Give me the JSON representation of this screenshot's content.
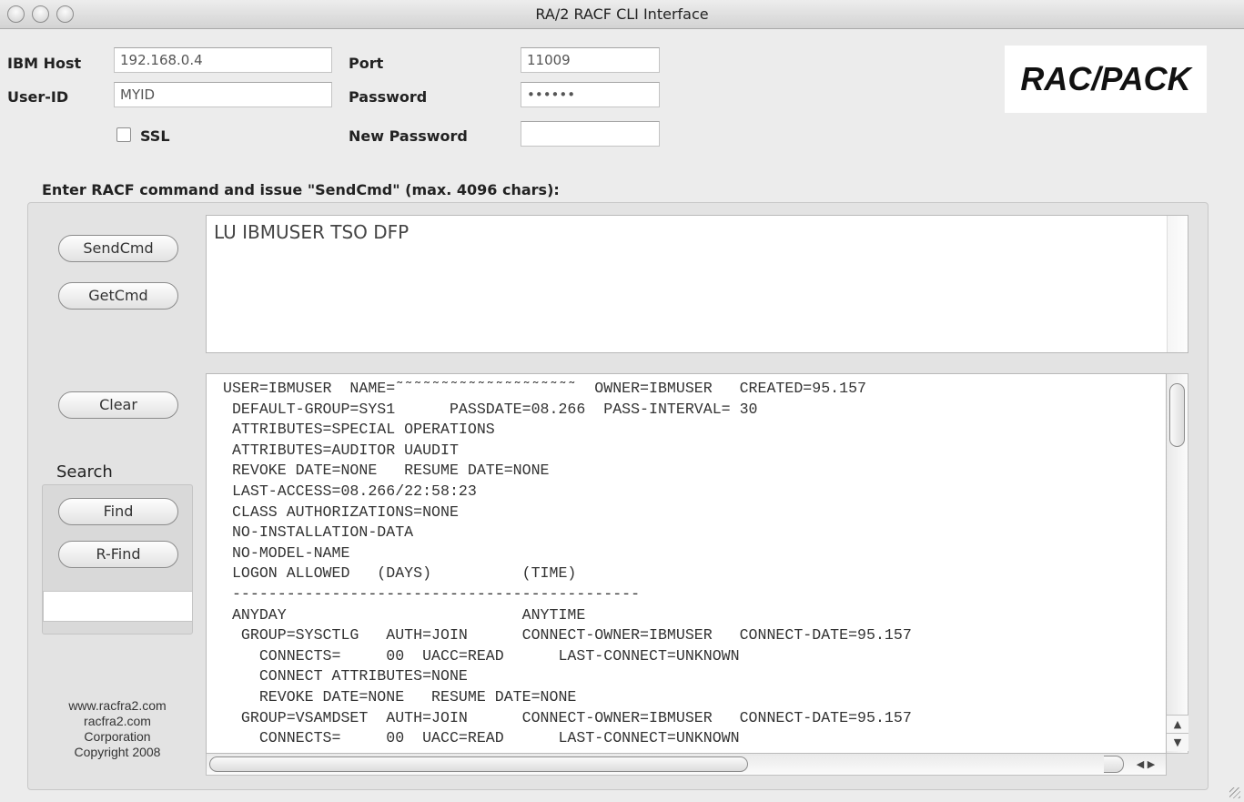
{
  "window": {
    "title": "RA/2 RACF CLI Interface"
  },
  "connection": {
    "host_label": "IBM Host",
    "host_value": "192.168.0.4",
    "port_label": "Port",
    "port_value": "11009",
    "userid_label": "User-ID",
    "userid_value": "MYID",
    "password_label": "Password",
    "password_value": "••••••",
    "ssl_label": "SSL",
    "ssl_checked": false,
    "new_password_label": "New Password",
    "new_password_value": ""
  },
  "logo": {
    "text": "RAC/PACK"
  },
  "command": {
    "prompt": "Enter RACF command and issue \"SendCmd\" (max. 4096 chars):",
    "input_value": "LU IBMUSER TSO DFP"
  },
  "buttons": {
    "send": "SendCmd",
    "get": "GetCmd",
    "clear": "Clear",
    "find": "Find",
    "rfind": "R-Find"
  },
  "search": {
    "label": "Search",
    "value": ""
  },
  "output": {
    "text": "USER=IBMUSER  NAME=˜˜˜˜˜˜˜˜˜˜˜˜˜˜˜˜˜˜˜˜  OWNER=IBMUSER   CREATED=95.157\n DEFAULT-GROUP=SYS1      PASSDATE=08.266  PASS-INTERVAL= 30\n ATTRIBUTES=SPECIAL OPERATIONS\n ATTRIBUTES=AUDITOR UAUDIT\n REVOKE DATE=NONE   RESUME DATE=NONE\n LAST-ACCESS=08.266/22:58:23\n CLASS AUTHORIZATIONS=NONE\n NO-INSTALLATION-DATA\n NO-MODEL-NAME\n LOGON ALLOWED   (DAYS)          (TIME)\n ---------------------------------------------\n ANYDAY                          ANYTIME\n  GROUP=SYSCTLG   AUTH=JOIN      CONNECT-OWNER=IBMUSER   CONNECT-DATE=95.157\n    CONNECTS=     00  UACC=READ      LAST-CONNECT=UNKNOWN\n    CONNECT ATTRIBUTES=NONE\n    REVOKE DATE=NONE   RESUME DATE=NONE\n  GROUP=VSAMDSET  AUTH=JOIN      CONNECT-OWNER=IBMUSER   CONNECT-DATE=95.157\n    CONNECTS=     00  UACC=READ      LAST-CONNECT=UNKNOWN"
  },
  "footer": {
    "line1": "www.racfra2.com",
    "line2": "racfra2.com",
    "line3": "Corporation",
    "line4": "Copyright 2008"
  },
  "icons": {
    "up_arrow": "▲",
    "down_arrow": "▼",
    "left_arrow": "◀",
    "right_arrow": "▶"
  }
}
